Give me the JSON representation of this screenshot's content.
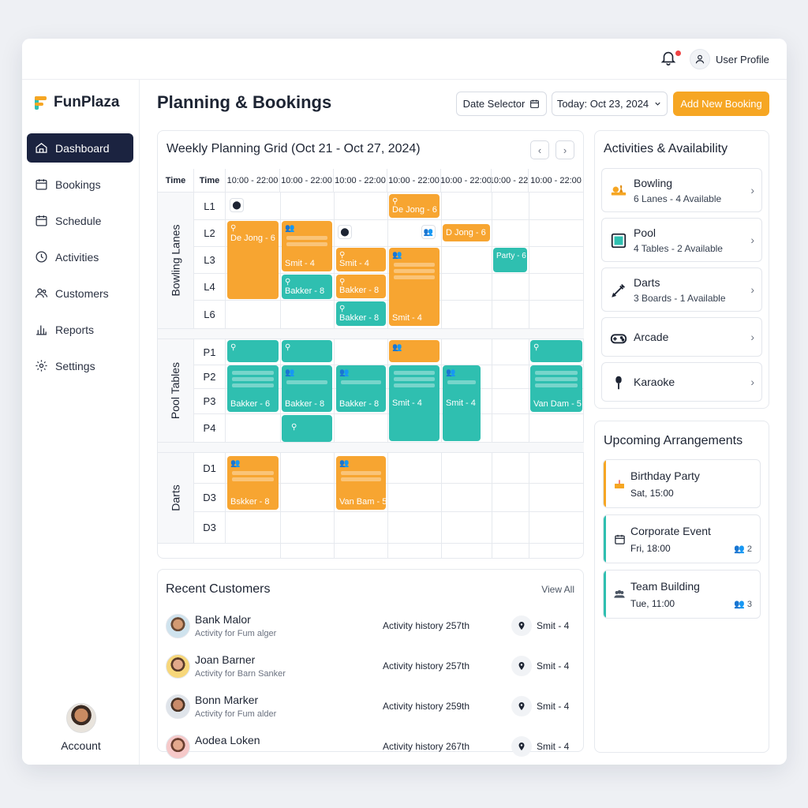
{
  "brand": {
    "name": "FunPlaza",
    "accent": "#f6a623",
    "teal": "#2fbfb0",
    "dark": "#1b2340"
  },
  "topbar": {
    "user_label": "User Profile",
    "icons": [
      "bell-icon",
      "user-icon"
    ]
  },
  "sidebar": {
    "items": [
      {
        "label": "Dashboard",
        "icon": "home-icon",
        "active": true
      },
      {
        "label": "Bookings",
        "icon": "calendar-icon"
      },
      {
        "label": "Schedule",
        "icon": "schedule-icon"
      },
      {
        "label": "Activities",
        "icon": "clock-icon"
      },
      {
        "label": "Customers",
        "icon": "users-icon"
      },
      {
        "label": "Reports",
        "icon": "chart-icon"
      },
      {
        "label": "Settings",
        "icon": "gear-icon"
      }
    ],
    "account_label": "Account"
  },
  "header": {
    "title": "Planning & Bookings",
    "date_selector": "Date Selector",
    "today": "Today: Oct 23, 2024",
    "add_booking": "Add New Booking"
  },
  "grid": {
    "title": "Weekly Planning Grid (Oct 21 - Oct 27, 2024)",
    "col_headers": [
      "Time",
      "Time",
      "10:00 - 22:00",
      "10:00 - 22:00",
      "10:00 - 22:00",
      "10:00 - 22:00",
      "10:00 - 22:00",
      "10:00 - 22:",
      "10:00 - 22:00"
    ],
    "sections": [
      {
        "label": "Bowling Lanes",
        "rows": [
          "L1",
          "L2",
          "L3",
          "L4",
          "L6"
        ]
      },
      {
        "label": "Pool Tables",
        "rows": [
          "P1",
          "P2",
          "P3",
          "P4"
        ]
      },
      {
        "label": "Darts",
        "rows": [
          "D1",
          "D3",
          "D3"
        ]
      }
    ],
    "bookings": {
      "b_dejong_l2": "De Jong - 6",
      "b_smit_l3a": "Smit - 4",
      "b_bakker_l4a": "Bakker - 8",
      "b_smit_l3b": "Smit - 4",
      "b_bakker_l4b": "Bakker - 8",
      "b_bakker_l6": "Bakker - 8",
      "b_dejong_l1": "De Jong - 6",
      "b_smit_l6": "Smit - 4",
      "b_djong_l2": "D Jong - 6",
      "b_party_l3": "Party - 6",
      "b_bakker_p3a": "Bakker - 6",
      "b_bakker_p3b": "Bakker - 8",
      "b_bakker_p3c": "Bakker - 8",
      "b_smit_p3a": "Smit - 4",
      "b_smit_p3b": "Smit - 4",
      "b_vandam_p3": "Van Dam - 5",
      "b_bskker_d1": "Bskker - 8",
      "b_vanbam_d1": "Van Bam - 5"
    }
  },
  "recent": {
    "title": "Recent Customers",
    "view_all": "View All",
    "rows": [
      {
        "name": "Bank Malor",
        "sub": "Activity for Fum alger",
        "history": "Activity history 257th",
        "ref": "Smit - 4"
      },
      {
        "name": "Joan Barner",
        "sub": "Activity for Barn Sanker",
        "history": "Activity history 257th",
        "ref": "Smit - 4"
      },
      {
        "name": "Bonn Marker",
        "sub": "Activity for Fum alder",
        "history": "Activity history 259th",
        "ref": "Smit - 4"
      },
      {
        "name": "Aodea Loken",
        "sub": "",
        "history": "Activity history 267th",
        "ref": "Smit - 4"
      }
    ]
  },
  "activities": {
    "title": "Activities & Availability",
    "items": [
      {
        "name": "Bowling",
        "detail": "6 Lanes - 4 Available",
        "icon": "bowling-icon"
      },
      {
        "name": "Pool",
        "detail": "4 Tables - 2 Available",
        "icon": "pool-table-icon"
      },
      {
        "name": "Darts",
        "detail": "3 Boards - 1 Available",
        "icon": "darts-icon"
      },
      {
        "name": "Arcade",
        "detail": "",
        "icon": "gamepad-icon"
      },
      {
        "name": "Karaoke",
        "detail": "",
        "icon": "microphone-icon"
      }
    ]
  },
  "upcoming": {
    "title": "Upcoming Arrangements",
    "items": [
      {
        "name": "Birthday Party",
        "time": "Sat, 15:00",
        "count": "",
        "color": "#f6a623",
        "icon": "cake-icon"
      },
      {
        "name": "Corporate Event",
        "time": "Fri, 18:00",
        "count": "2",
        "color": "#2fbfb0",
        "icon": "calendar-icon"
      },
      {
        "name": "Team Building",
        "time": "Tue, 11:00",
        "count": "3",
        "color": "#2fbfb0",
        "icon": "group-icon"
      }
    ]
  }
}
